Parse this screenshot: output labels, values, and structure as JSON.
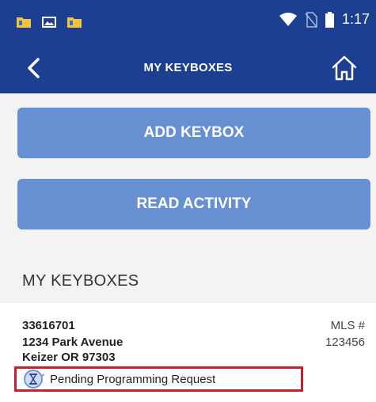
{
  "statusbar": {
    "time": "1:17",
    "icons": [
      "folder-notification-icon",
      "image-notification-icon",
      "folder-notification-icon",
      "wifi-icon",
      "no-sim-icon",
      "battery-icon"
    ]
  },
  "appbar": {
    "title": "MY KEYBOXES",
    "back_icon": "back-chevron-icon",
    "home_icon": "home-icon"
  },
  "actions": {
    "add_keybox": "ADD KEYBOX",
    "read_activity": "READ ACTIVITY"
  },
  "section": {
    "heading": "MY KEYBOXES"
  },
  "keybox": {
    "id": "33616701",
    "address_line1": "1234 Park Avenue",
    "address_line2": "Keizer OR 97303",
    "mls_label": "MLS #",
    "mls_number": "123456",
    "status_icon": "hourglass-icon",
    "status": "Pending Programming Request"
  },
  "colors": {
    "appbar": "#1c3f91",
    "button": "#6690d2",
    "highlight": "#c8202a"
  }
}
